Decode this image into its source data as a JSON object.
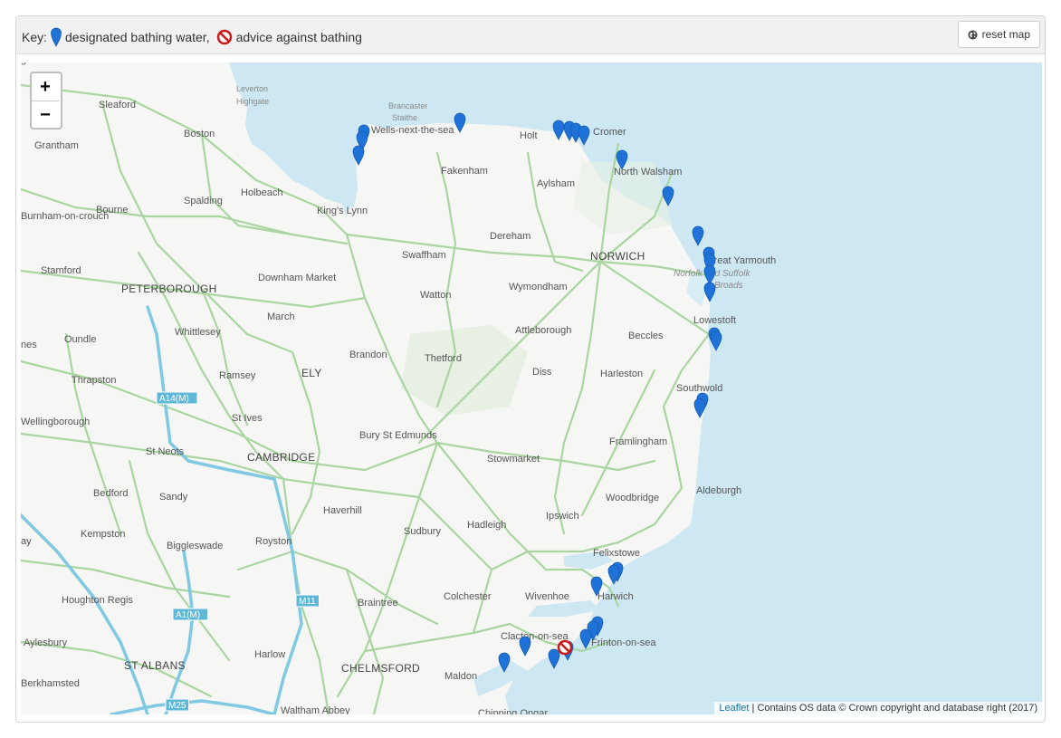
{
  "header": {
    "key_label": "Key:",
    "designated_label": "designated bathing water,",
    "advice_label": "advice against bathing",
    "reset_label": "reset map"
  },
  "zoom": {
    "in_label": "+",
    "out_label": "−"
  },
  "attribution": {
    "leaflet_label": "Leaflet",
    "separator": " | ",
    "text": "Contains OS data © Crown copyright and database right (2017)"
  },
  "colors": {
    "sea": "#cde8f3",
    "land": "#f6f6f4",
    "road": "#a8d5a0",
    "motorway": "#7fc9e3",
    "marker": "#1f73d8",
    "warning": "#cc1818"
  },
  "places": [
    {
      "name": "Leverton",
      "cls": "small"
    },
    {
      "name": "Highgate",
      "cls": "small"
    },
    {
      "name": "Sleaford",
      "cls": ""
    },
    {
      "name": "Grantham",
      "cls": ""
    },
    {
      "name": "Boston",
      "cls": ""
    },
    {
      "name": "Brancaster",
      "cls": "small"
    },
    {
      "name": "Staithe",
      "cls": "small"
    },
    {
      "name": "Wells-next-the-sea",
      "cls": ""
    },
    {
      "name": "Holt",
      "cls": ""
    },
    {
      "name": "Cromer",
      "cls": ""
    },
    {
      "name": "Fakenham",
      "cls": ""
    },
    {
      "name": "North Walsham",
      "cls": ""
    },
    {
      "name": "Holbeach",
      "cls": ""
    },
    {
      "name": "Spalding",
      "cls": ""
    },
    {
      "name": "Aylsham",
      "cls": ""
    },
    {
      "name": "Bourne",
      "cls": ""
    },
    {
      "name": "King's Lynn",
      "cls": ""
    },
    {
      "name": "Dereham",
      "cls": ""
    },
    {
      "name": "Swaffham",
      "cls": ""
    },
    {
      "name": "NORWICH",
      "cls": "big"
    },
    {
      "name": "Great Yarmouth",
      "cls": ""
    },
    {
      "name": "Stamford",
      "cls": ""
    },
    {
      "name": "Downham Market",
      "cls": ""
    },
    {
      "name": "Norfolk and Suffolk",
      "cls": "area"
    },
    {
      "name": "Broads",
      "cls": "area"
    },
    {
      "name": "PETERBOROUGH",
      "cls": "big"
    },
    {
      "name": "Wymondham",
      "cls": ""
    },
    {
      "name": "Watton",
      "cls": ""
    },
    {
      "name": "March",
      "cls": ""
    },
    {
      "name": "Whittlesey",
      "cls": ""
    },
    {
      "name": "Lowestoft",
      "cls": ""
    },
    {
      "name": "Oundle",
      "cls": ""
    },
    {
      "name": "Attleborough",
      "cls": ""
    },
    {
      "name": "Beccles",
      "cls": ""
    },
    {
      "name": "Brandon",
      "cls": ""
    },
    {
      "name": "Thetford",
      "cls": ""
    },
    {
      "name": "Thrapston",
      "cls": ""
    },
    {
      "name": "Ramsey",
      "cls": ""
    },
    {
      "name": "ELY",
      "cls": "big"
    },
    {
      "name": "Diss",
      "cls": ""
    },
    {
      "name": "Harleston",
      "cls": ""
    },
    {
      "name": "Southwold",
      "cls": ""
    },
    {
      "name": "A14(M)",
      "cls": "shield"
    },
    {
      "name": "Wellingborough",
      "cls": ""
    },
    {
      "name": "St Ives",
      "cls": ""
    },
    {
      "name": "Bury St Edmunds",
      "cls": ""
    },
    {
      "name": "Framlingham",
      "cls": ""
    },
    {
      "name": "St Neots",
      "cls": ""
    },
    {
      "name": "CAMBRIDGE",
      "cls": "big"
    },
    {
      "name": "Stowmarket",
      "cls": ""
    },
    {
      "name": "Aldeburgh",
      "cls": ""
    },
    {
      "name": "Bedford",
      "cls": ""
    },
    {
      "name": "Sandy",
      "cls": ""
    },
    {
      "name": "Woodbridge",
      "cls": ""
    },
    {
      "name": "Haverhill",
      "cls": ""
    },
    {
      "name": "Ipswich",
      "cls": ""
    },
    {
      "name": "Hadleigh",
      "cls": ""
    },
    {
      "name": "Sudbury",
      "cls": ""
    },
    {
      "name": "Kempston",
      "cls": ""
    },
    {
      "name": "Biggleswade",
      "cls": ""
    },
    {
      "name": "Royston",
      "cls": ""
    },
    {
      "name": "Felixstowe",
      "cls": ""
    },
    {
      "name": "Harwich",
      "cls": ""
    },
    {
      "name": "Colchester",
      "cls": ""
    },
    {
      "name": "Houghton Regis",
      "cls": ""
    },
    {
      "name": "M11",
      "cls": "shield"
    },
    {
      "name": "Braintree",
      "cls": ""
    },
    {
      "name": "Wivenhoe",
      "cls": ""
    },
    {
      "name": "A1(M)",
      "cls": "shield"
    },
    {
      "name": "Clacton-on-sea",
      "cls": ""
    },
    {
      "name": "Frinton-on-sea",
      "cls": ""
    },
    {
      "name": "Aylesbury",
      "cls": ""
    },
    {
      "name": "Harlow",
      "cls": ""
    },
    {
      "name": "ST ALBANS",
      "cls": "big"
    },
    {
      "name": "CHELMSFORD",
      "cls": "big"
    },
    {
      "name": "Maldon",
      "cls": ""
    },
    {
      "name": "Berkhamsted",
      "cls": ""
    },
    {
      "name": "M25",
      "cls": "shield"
    },
    {
      "name": "Waltham Abbey",
      "cls": ""
    },
    {
      "name": "Chipping Ongar",
      "cls": ""
    },
    {
      "name": "Burnham-on-crouch",
      "cls": ""
    },
    {
      "name": "ay",
      "cls": ""
    },
    {
      "name": "nes",
      "cls": ""
    },
    {
      "name": "gh",
      "cls": ""
    }
  ]
}
